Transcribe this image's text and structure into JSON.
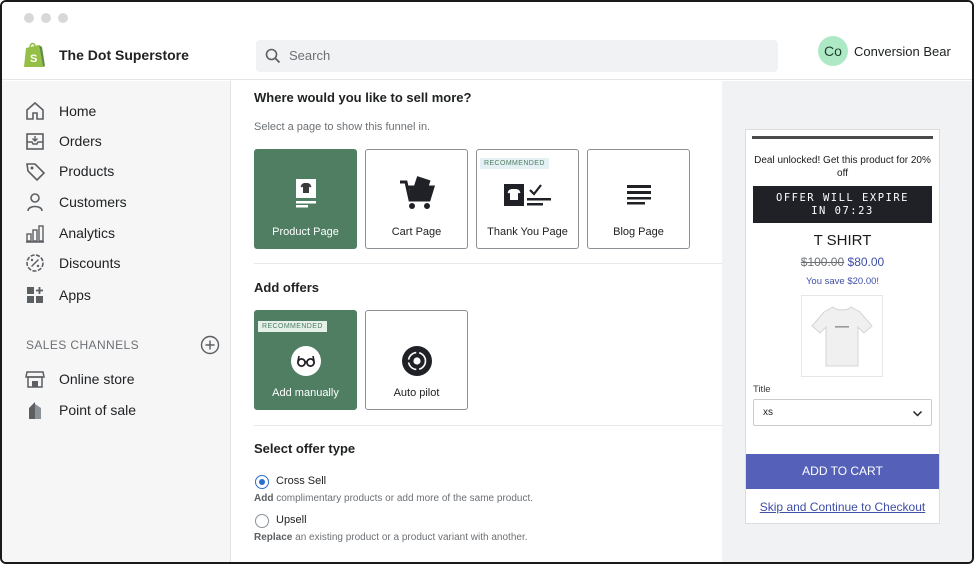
{
  "app": {
    "store_name": "The Dot Superstore",
    "search_placeholder": "Search",
    "user_initials": "Co",
    "user_name": "Conversion Bear",
    "accent": "#4f7e62"
  },
  "sidebar": {
    "items": [
      {
        "label": "Home",
        "icon": "home-icon"
      },
      {
        "label": "Orders",
        "icon": "orders-icon"
      },
      {
        "label": "Products",
        "icon": "tag-icon"
      },
      {
        "label": "Customers",
        "icon": "person-icon"
      },
      {
        "label": "Analytics",
        "icon": "bar-chart-icon"
      },
      {
        "label": "Discounts",
        "icon": "discount-icon"
      },
      {
        "label": "Apps",
        "icon": "apps-icon"
      }
    ],
    "channels_title": "SALES CHANNELS",
    "channels": [
      {
        "label": "Online store",
        "icon": "store-icon"
      },
      {
        "label": "Point of sale",
        "icon": "pos-icon"
      }
    ]
  },
  "main": {
    "sell_title": "Where would you like to sell more?",
    "sell_sub": "Select a page to show this funnel in.",
    "pages": [
      {
        "label": "Product Page",
        "selected": true
      },
      {
        "label": "Cart Page",
        "selected": false
      },
      {
        "label": "Thank You Page",
        "selected": false,
        "badge": "RECOMMENDED"
      },
      {
        "label": "Blog Page",
        "selected": false
      }
    ],
    "offers_title": "Add offers",
    "offers": [
      {
        "label": "Add manually",
        "selected": true,
        "badge": "RECOMMENDED"
      },
      {
        "label": "Auto pilot",
        "selected": false
      }
    ],
    "offer_type_title": "Select offer type",
    "offer_types": [
      {
        "label": "Cross Sell",
        "checked": true,
        "desc_bold": "Add",
        "desc": " complimentary products or add more of the same product."
      },
      {
        "label": "Upsell",
        "checked": false,
        "desc_bold": "Replace",
        "desc": " an existing product or a product variant with another."
      }
    ]
  },
  "preview": {
    "deal_text": "Deal unlocked! Get this product for 20% off",
    "timer_line1": "OFFER WILL EXPIRE",
    "timer_line2": "IN 07:23",
    "product_title": "T SHIRT",
    "old_price": "$100.00",
    "new_price": "$80.00",
    "savings": "You save $20.00!",
    "option_label": "Title",
    "option_value": "xs",
    "cart_button": "ADD TO CART",
    "skip_link": "Skip and Continue to Checkout",
    "price_color": "#3f4ea6",
    "button_color": "#5561b8"
  }
}
